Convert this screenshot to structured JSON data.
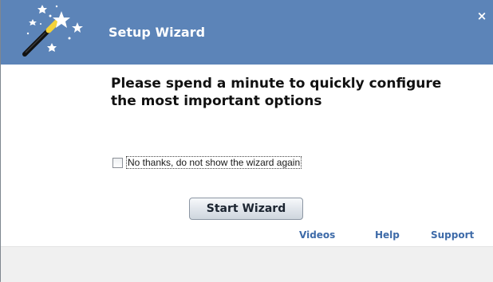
{
  "titlebar": {
    "title": "Setup Wizard",
    "icon": "magic-wand-icon",
    "close_label": "×",
    "color": "#5c84b8"
  },
  "main": {
    "heading_line1": "Please spend a minute to quickly configure",
    "heading_line2": "the most important options",
    "checkbox_label": "No thanks, do not show the wizard again",
    "checkbox_checked": false,
    "start_button_label": "Start Wizard"
  },
  "links": {
    "videos": "Videos",
    "help": "Help",
    "support": "Support",
    "color": "#3d6aa8"
  }
}
